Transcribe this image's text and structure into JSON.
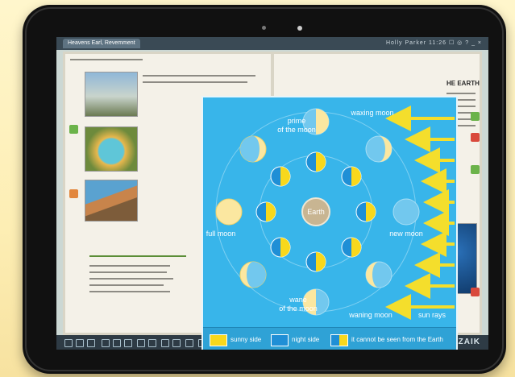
{
  "app": {
    "tab_title": "Heavens Earl, Revemment",
    "status_right": "Holly Parker  11:26  ☐ ◎ ? _ ×",
    "brand": "MOZAIK"
  },
  "book": {
    "right_heading": "HE EARTH"
  },
  "diagram": {
    "earth_label": "Earth",
    "labels": {
      "prime": "prime",
      "of_the_moon_top": "of the moon",
      "waxing": "waxing moon",
      "full": "full moon",
      "new": "new moon",
      "wane": "wane",
      "of_the_moon_bottom": "of the moon",
      "waning": "waning moon",
      "sun_rays": "sun rays"
    },
    "legend": [
      {
        "label": "sunny side",
        "color": "#f8d81c"
      },
      {
        "label": "night side",
        "color": "#1f8fd6"
      },
      {
        "label": "it cannot be seen from the Earth",
        "color": "#1f8fd6"
      }
    ]
  },
  "colors": {
    "sunny": "#f8d81c",
    "night": "#1f8fd6",
    "background": "#38b5ea",
    "arrow": "#f4de2c"
  }
}
